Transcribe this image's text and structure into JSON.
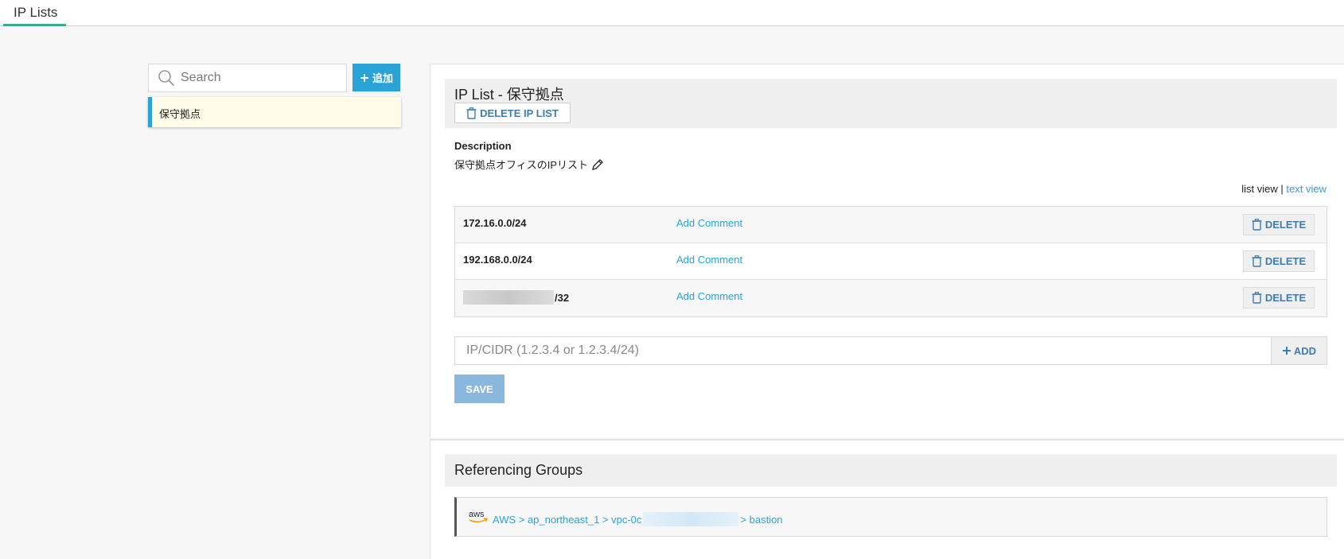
{
  "topbar": {
    "tab_label": "IP Lists"
  },
  "sidebar": {
    "search_placeholder": "Search",
    "add_label": "追加",
    "items": [
      {
        "label": "保守拠点"
      }
    ]
  },
  "ip_list": {
    "title": "IP List - 保守拠点",
    "delete_list_label": "DELETE IP LIST",
    "description_label": "Description",
    "description_text": "保守拠点オフィスのIPリスト",
    "view_list": "list view",
    "view_separator": "|",
    "view_text": "text view",
    "entries": [
      {
        "ip": "172.16.0.0/24",
        "comment_label": "Add Comment",
        "delete_label": "DELETE"
      },
      {
        "ip": "192.168.0.0/24",
        "comment_label": "Add Comment",
        "delete_label": "DELETE"
      },
      {
        "ip": "/32",
        "comment_label": "Add Comment",
        "delete_label": "DELETE"
      }
    ],
    "cidr_placeholder": "IP/CIDR (1.2.3.4 or 1.2.3.4/24)",
    "cidr_add_label": "ADD",
    "save_label": "SAVE"
  },
  "referencing": {
    "title": "Referencing Groups",
    "logo_text": "aws",
    "path_prefix": "AWS > ap_northeast_1 > vpc-0c",
    "path_suffix": "> bastion"
  },
  "colors": {
    "accent": "#2ba3d6",
    "tab_underline": "#3aaa94",
    "button_text": "#3e7cb1",
    "save_disabled": "#8ab7dd"
  }
}
